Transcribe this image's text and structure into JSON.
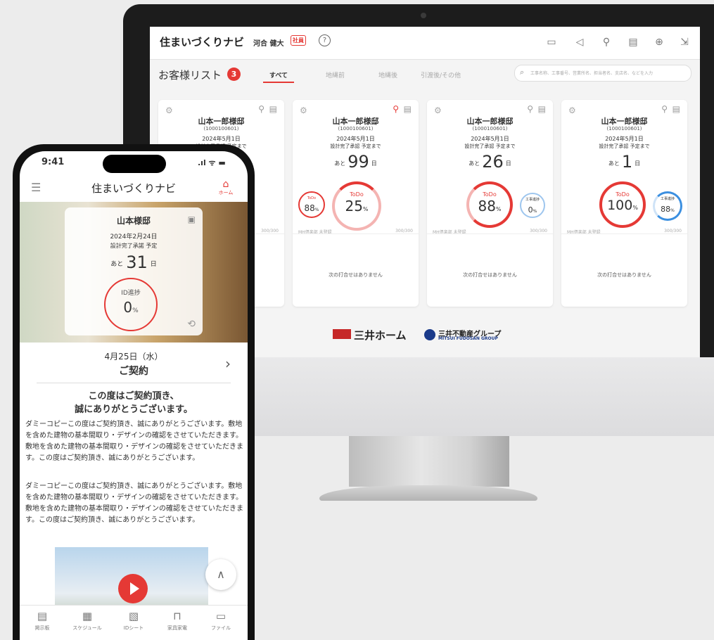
{
  "colors": {
    "accent": "#e53935",
    "blue": "#3b8fe0",
    "brand_navy": "#1a3a8a"
  },
  "desktop": {
    "app_title": "住まいづくりナビ",
    "user_name": "河合 健大",
    "staff_badge": "社員",
    "help": "?",
    "toolbar_icons": [
      "folder-icon",
      "megaphone-icon",
      "pin-icon",
      "building-icon",
      "plus-circle-icon",
      "logout-icon"
    ],
    "heading": "お客様リスト",
    "count": "3",
    "tabs": [
      "すべて",
      "地縄前",
      "地縄後",
      "引渡後/その他"
    ],
    "search_placeholder": "工事名称、工事番号、営業所名、担当者名、支店名、などを入力",
    "cards": [
      {
        "name": "山本一郎様邸",
        "code": "(1000100601)",
        "date": "2024年5月1日",
        "sub": "設計完了承認 予定まで",
        "days_prefix": "あと",
        "days": "",
        "days_suffix": "日",
        "todo_small": "",
        "todo_small_label": "",
        "todo_big": "",
        "todo_big_label": "",
        "construct_label": "",
        "construct": "",
        "mh": "",
        "score": "300/300",
        "no_plan": "",
        "pinned": false
      },
      {
        "name": "山本一郎様邸",
        "code": "(1000100601)",
        "date": "2024年5月1日",
        "sub": "設計完了承認 予定まで",
        "days_prefix": "あと",
        "days": "99",
        "days_suffix": "日",
        "todo_small_label": "ToDo",
        "todo_small": "88",
        "todo_big_label": "ToDo",
        "todo_big": "25",
        "mh": "MH倶楽部 未登録",
        "score": "300/300",
        "no_plan": "次の打合せはありません",
        "pinned": true
      },
      {
        "name": "山本一郎様邸",
        "code": "(1000100601)",
        "date": "2024年5月1日",
        "sub": "設計完了承認 予定まで",
        "days_prefix": "あと",
        "days": "26",
        "days_suffix": "日",
        "todo_big_label": "ToDo",
        "todo_big": "88",
        "construct_label": "工事進捗",
        "construct": "0",
        "mh": "MH倶楽部 未登録",
        "score": "300/300",
        "no_plan": "次の打合せはありません",
        "pinned": false
      },
      {
        "name": "山本一郎様邸",
        "code": "(1000100601)",
        "date": "2024年5月1日",
        "sub": "設計完了承認 予定まで",
        "days_prefix": "あと",
        "days": "1",
        "days_suffix": "日",
        "todo_big_label": "ToDo",
        "todo_big": "100",
        "construct_label": "工事進捗",
        "construct": "88",
        "mh": "MH倶楽部 未登録",
        "score": "300/300",
        "no_plan": "次の打合せはありません",
        "pinned": false
      }
    ],
    "logo1": "三井ホーム",
    "logo1_small": "MITSUI HOME",
    "logo2": "三井不動産グループ",
    "logo2_sub": "MITSUI FUDOSAN GROUP"
  },
  "phone": {
    "time": "9:41",
    "status": ".ıl ᯤ ▬",
    "title": "住まいづくりナビ",
    "home_label": "ホーム",
    "hero": {
      "name": "山本様邸",
      "date": "2024年2月24日",
      "sub": "設計完了承諾 予定",
      "days_prefix": "あと",
      "days": "31",
      "days_suffix": "日",
      "ring_label": "ID進捗",
      "ring_value": "0",
      "ring_unit": "%"
    },
    "event_date": "4月25日（水）",
    "event_title": "ご契約",
    "msg_title1": "この度はご契約頂き、",
    "msg_title2": "誠にありがとうございます。",
    "para1": "ダミーコピーこの度はご契約頂き、誠にありがとうございます。敷地を含めた建物の基本間取り・デザインの確認をさせていただきます。敷地を含めた建物の基本間取り・デザインの確認をさせていただきます。この度はご契約頂き、誠にありがとうございます。",
    "para2": "ダミーコピーこの度はご契約頂き、誠にありがとうございます。敷地を含めた建物の基本間取り・デザインの確認をさせていただきます。敷地を含めた建物の基本間取り・デザインの確認をさせていただきます。この度はご契約頂き、誠にありがとうございます。",
    "nav": [
      {
        "label": "掲示板",
        "icon": "board-icon"
      },
      {
        "label": "スケジュール",
        "icon": "calendar-icon"
      },
      {
        "label": "IDシート",
        "icon": "sheet-icon"
      },
      {
        "label": "家具家電",
        "icon": "sofa-icon"
      },
      {
        "label": "ファイル",
        "icon": "folder-icon"
      }
    ]
  }
}
